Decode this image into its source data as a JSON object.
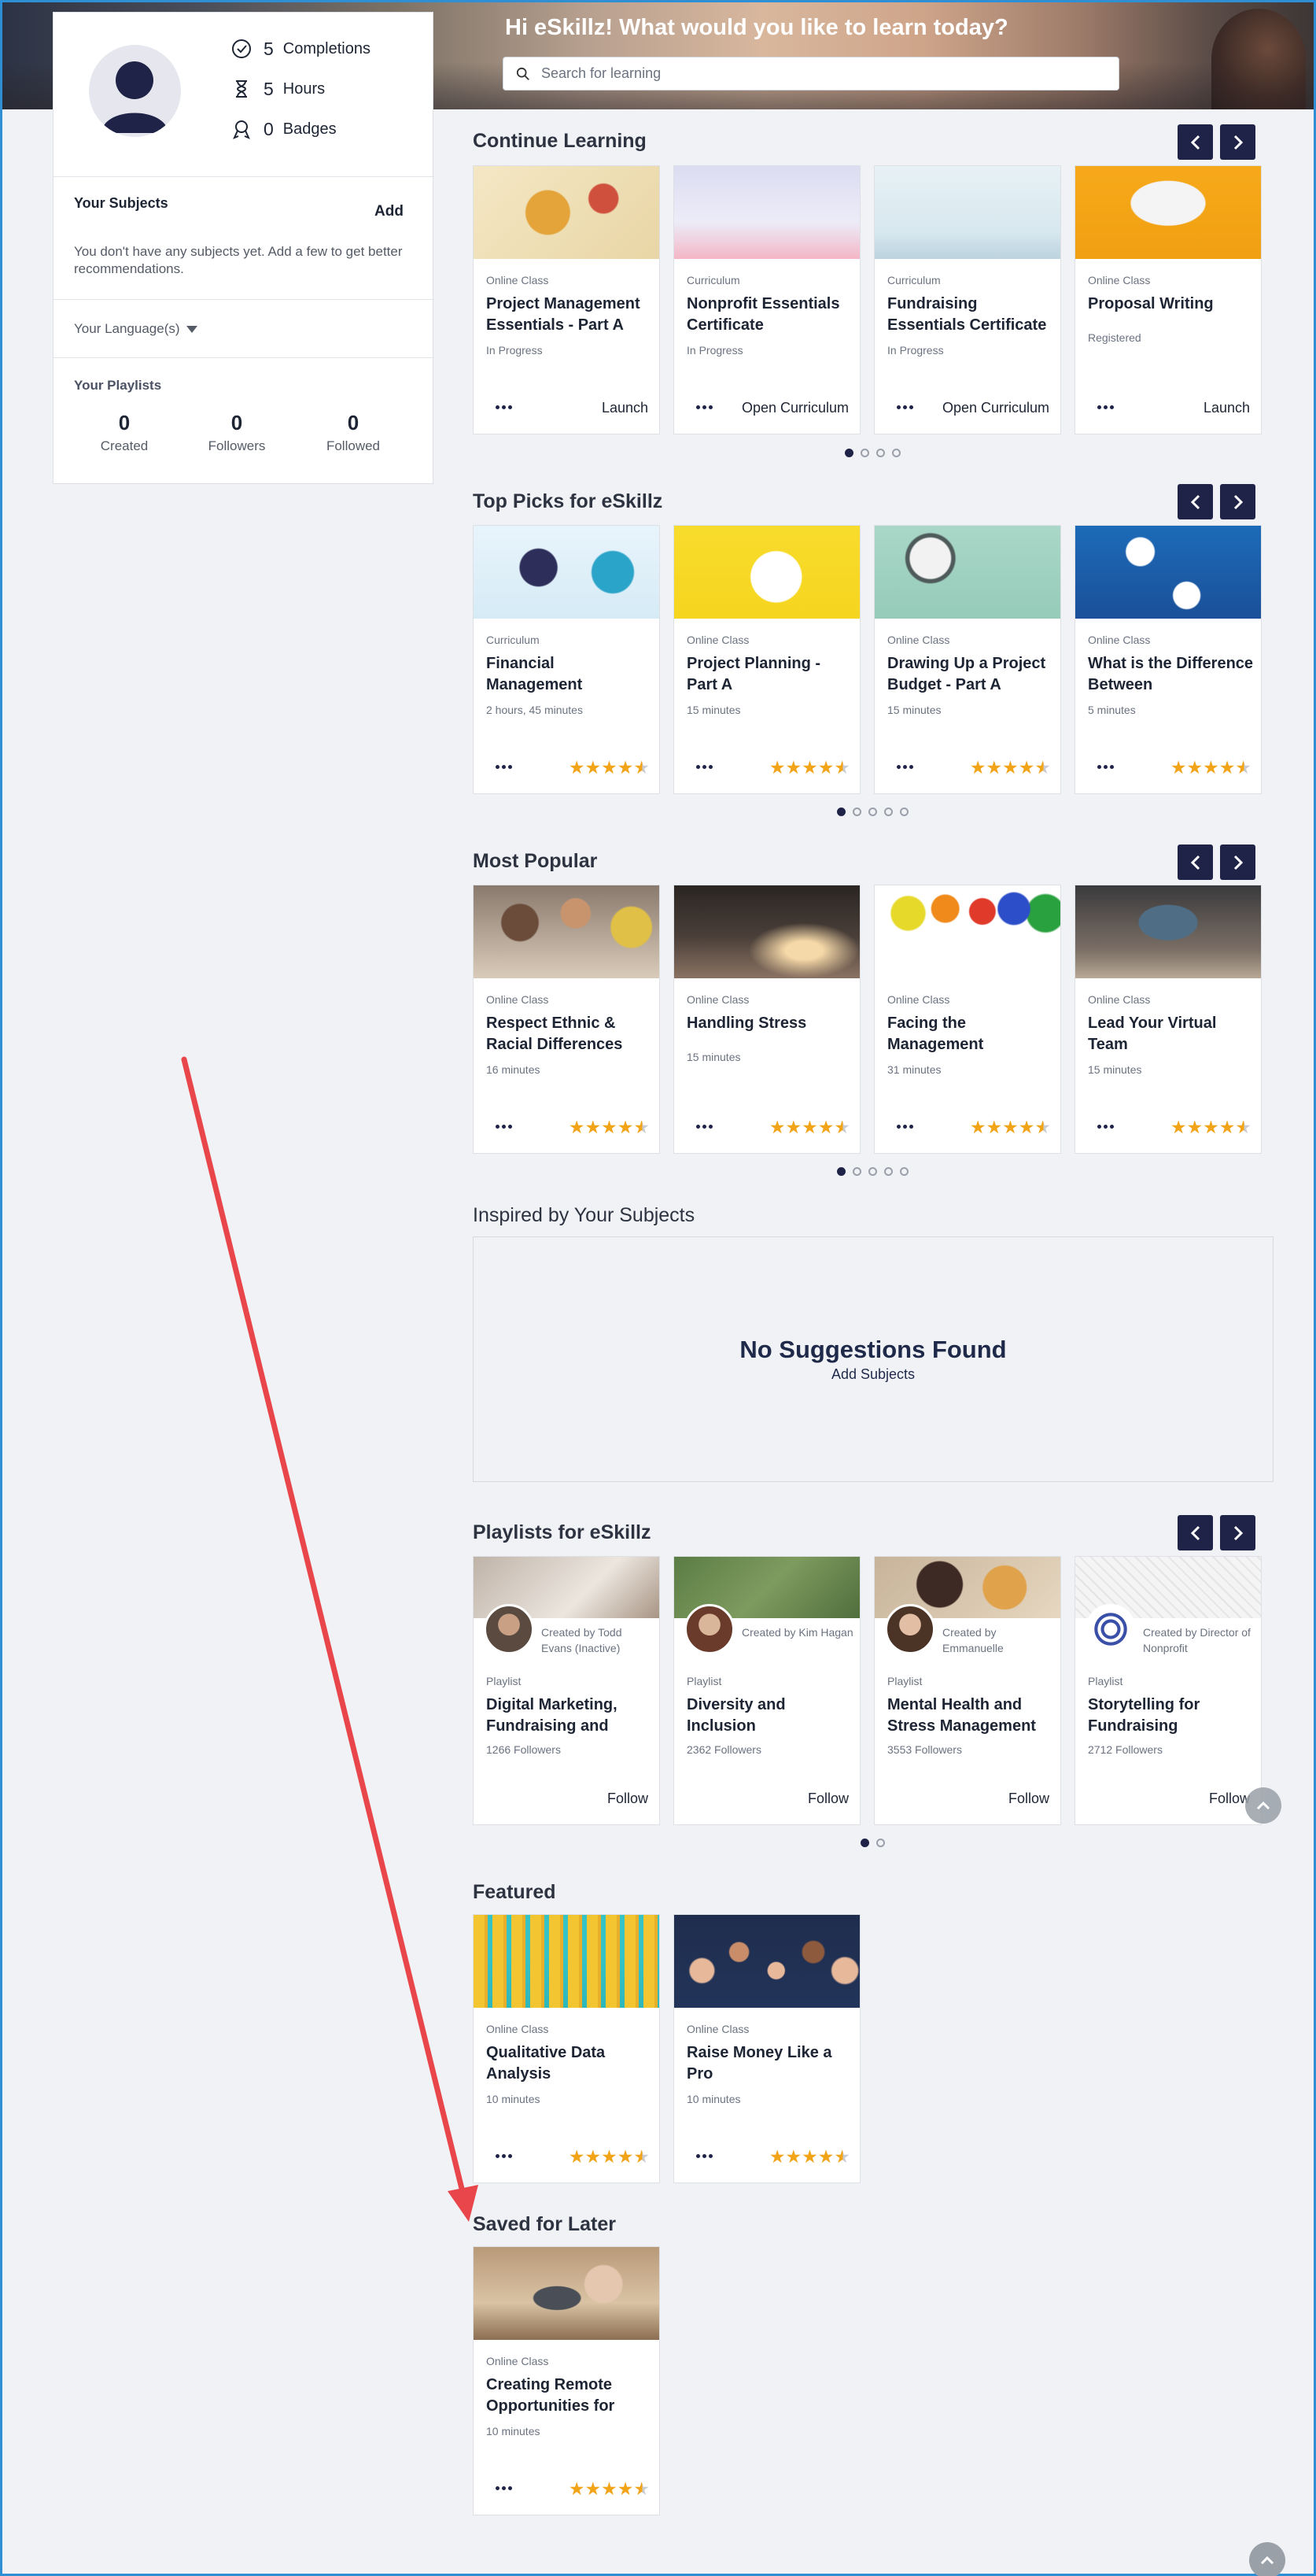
{
  "hero": {
    "title": "Hi eSkillz! What would you like to learn today?",
    "search_placeholder": "Search for learning"
  },
  "profile": {
    "stats": [
      {
        "value": "5",
        "label": "Completions",
        "icon": "check-circle-icon"
      },
      {
        "value": "5",
        "label": "Hours",
        "icon": "hourglass-icon"
      },
      {
        "value": "0",
        "label": "Badges",
        "icon": "award-icon"
      }
    ],
    "subjects_title": "Your Subjects",
    "add_label": "Add",
    "subjects_note": "You don't have any subjects yet. Add a few to get better recommendations.",
    "language_label": "Your Language(s)",
    "playlists_title": "Your Playlists",
    "playlist_stats": [
      {
        "value": "0",
        "label": "Created"
      },
      {
        "value": "0",
        "label": "Followers"
      },
      {
        "value": "0",
        "label": "Followed"
      }
    ]
  },
  "continue": {
    "title": "Continue Learning",
    "cards": [
      {
        "type": "Online Class",
        "title": "Project Management Essentials - Part A",
        "meta": "In Progress",
        "action": "Launch"
      },
      {
        "type": "Curriculum",
        "title": "Nonprofit Essentials Certificate",
        "meta": "In Progress",
        "action": "Open Curriculum"
      },
      {
        "type": "Curriculum",
        "title": "Fundraising Essentials Certificate",
        "meta": "In Progress",
        "action": "Open Curriculum"
      },
      {
        "type": "Online Class",
        "title": "Proposal Writing",
        "meta": "Registered",
        "action": "Launch"
      }
    ]
  },
  "top_picks": {
    "title": "Top Picks for eSkillz",
    "cards": [
      {
        "type": "Curriculum",
        "title": "Financial Management",
        "meta": "2 hours, 45 minutes",
        "rating": 4.5
      },
      {
        "type": "Online Class",
        "title": "Project Planning - Part A",
        "meta": "15 minutes",
        "rating": 4.5
      },
      {
        "type": "Online Class",
        "title": "Drawing Up a Project Budget - Part A",
        "meta": "15 minutes",
        "rating": 4.5
      },
      {
        "type": "Online Class",
        "title": "What is the Difference Between",
        "meta": "5 minutes",
        "rating": 4.5
      }
    ]
  },
  "popular": {
    "title": "Most Popular",
    "cards": [
      {
        "type": "Online Class",
        "title": "Respect Ethnic & Racial Differences",
        "meta": "16 minutes",
        "rating": 4.5
      },
      {
        "type": "Online Class",
        "title": "Handling Stress",
        "meta": "15 minutes",
        "rating": 4.5
      },
      {
        "type": "Online Class",
        "title": "Facing the Management",
        "meta": "31 minutes",
        "rating": 4.5
      },
      {
        "type": "Online Class",
        "title": "Lead Your Virtual Team",
        "meta": "15 minutes",
        "rating": 4.5
      }
    ]
  },
  "inspired": {
    "title": "Inspired by Your Subjects",
    "empty_title": "No Suggestions Found",
    "empty_link": "Add Subjects"
  },
  "playlists": {
    "title": "Playlists for eSkillz",
    "cards": [
      {
        "byline": "Created by Todd Evans (Inactive)",
        "type": "Playlist",
        "title": "Digital Marketing, Fundraising and",
        "followers": "1266 Followers",
        "action": "Follow"
      },
      {
        "byline": "Created by Kim Hagan",
        "type": "Playlist",
        "title": "Diversity and Inclusion",
        "followers": "2362 Followers",
        "action": "Follow"
      },
      {
        "byline": "Created by Emmanuelle",
        "type": "Playlist",
        "title": "Mental Health and Stress Management",
        "followers": "3553 Followers",
        "action": "Follow"
      },
      {
        "byline": "Created by Director of Nonprofit",
        "type": "Playlist",
        "title": "Storytelling for Fundraising",
        "followers": "2712 Followers",
        "action": "Follow"
      }
    ]
  },
  "featured": {
    "title": "Featured",
    "cards": [
      {
        "type": "Online Class",
        "title": "Qualitative Data Analysis",
        "meta": "10 minutes",
        "rating": 4.5
      },
      {
        "type": "Online Class",
        "title": "Raise Money Like a Pro",
        "meta": "10 minutes",
        "rating": 4.5
      }
    ]
  },
  "saved": {
    "title": "Saved for Later",
    "cards": [
      {
        "type": "Online Class",
        "title": "Creating Remote Opportunities for",
        "meta": "10 minutes",
        "rating": 4.5
      }
    ]
  },
  "carousel_pages": {
    "continue": [
      1,
      4
    ],
    "top_picks": [
      1,
      5
    ],
    "popular": [
      1,
      5
    ],
    "playlists": [
      1,
      2
    ]
  },
  "colors": {
    "accent": "#1f2347",
    "star": "#f2a419",
    "annotation_arrow": "#e8464a"
  }
}
